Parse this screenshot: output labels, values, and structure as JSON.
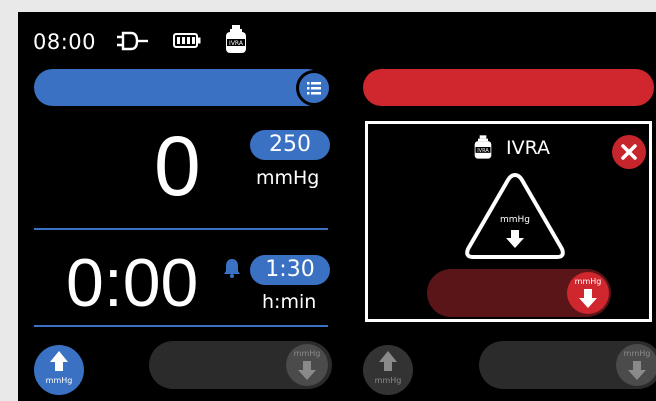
{
  "status_bar": {
    "time": "08:00",
    "icons": [
      "power-plug-icon",
      "battery-full-icon",
      "ivra-bottle-icon"
    ]
  },
  "left_panel": {
    "pressure_value": "0",
    "pressure_setpoint": "250",
    "pressure_unit": "mmHg",
    "elapsed_time": "0:00",
    "time_setpoint": "1:30",
    "time_unit": "h:min",
    "up_button_caption": "mmHg",
    "deflate_slider_caption": "mmHg"
  },
  "right_panel": {
    "dialog_title": "IVRA",
    "warning_caption": "mmHg",
    "deflate_slider_caption": "mmHg",
    "up_button_caption": "mmHg",
    "bottom_slider_caption": "mmHg"
  },
  "colors": {
    "accent_blue": "#3a71c2",
    "alert_red": "#d0262d",
    "background": "#000000"
  }
}
